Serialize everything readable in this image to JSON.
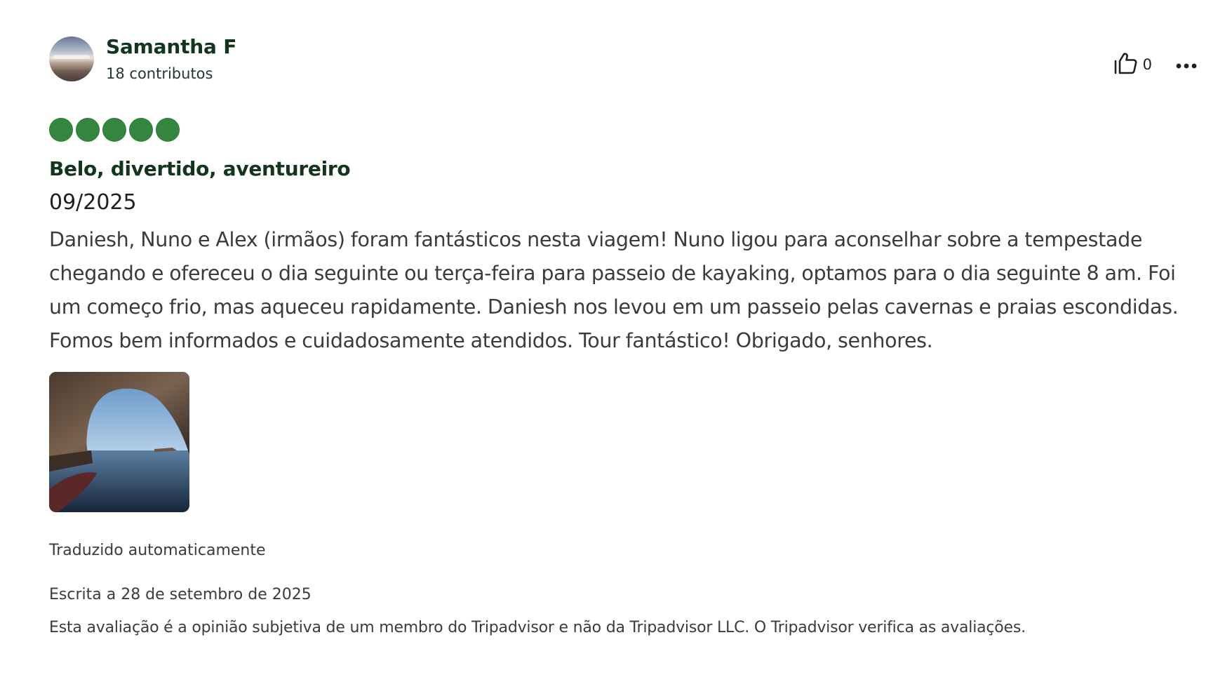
{
  "review": {
    "user": {
      "name": "Samantha F",
      "contributions": "18 contributos",
      "avatar_icon": "user-avatar-photo"
    },
    "actions": {
      "like_icon": "thumbs-up-icon",
      "like_count": "0",
      "more_icon": "more-horizontal-icon"
    },
    "rating": {
      "value": 5,
      "max": 5,
      "color": "#34863f"
    },
    "title": "Belo, divertido, aventureiro",
    "visit_date": "09/2025",
    "text": "Daniesh, Nuno e Alex (irmãos) foram fantásticos nesta viagem! Nuno ligou para aconselhar sobre a tempestade chegando e ofereceu o dia seguinte ou terça-feira para passeio de kayaking, optamos para o dia seguinte 8 am. Foi um começo frio, mas aqueceu rapidamente. Daniesh nos levou em um passeio pelas cavernas e praias escondidas. Fomos bem informados e cuidadosamente atendidos. Tour fantástico! Obrigado, senhores.",
    "photo_icon": "sea-cave-photo",
    "translated_note": "Traduzido automaticamente",
    "written_date": "Escrita a 28 de setembro de 2025",
    "disclaimer": "Esta avaliação é a opinião subjetiva de um membro do Tripadvisor e não da Tripadvisor LLC. O Tripadvisor verifica as avaliações."
  },
  "colors": {
    "title_green": "#12351d",
    "bubble_green": "#34863f",
    "body_text": "#3b3b3b"
  }
}
